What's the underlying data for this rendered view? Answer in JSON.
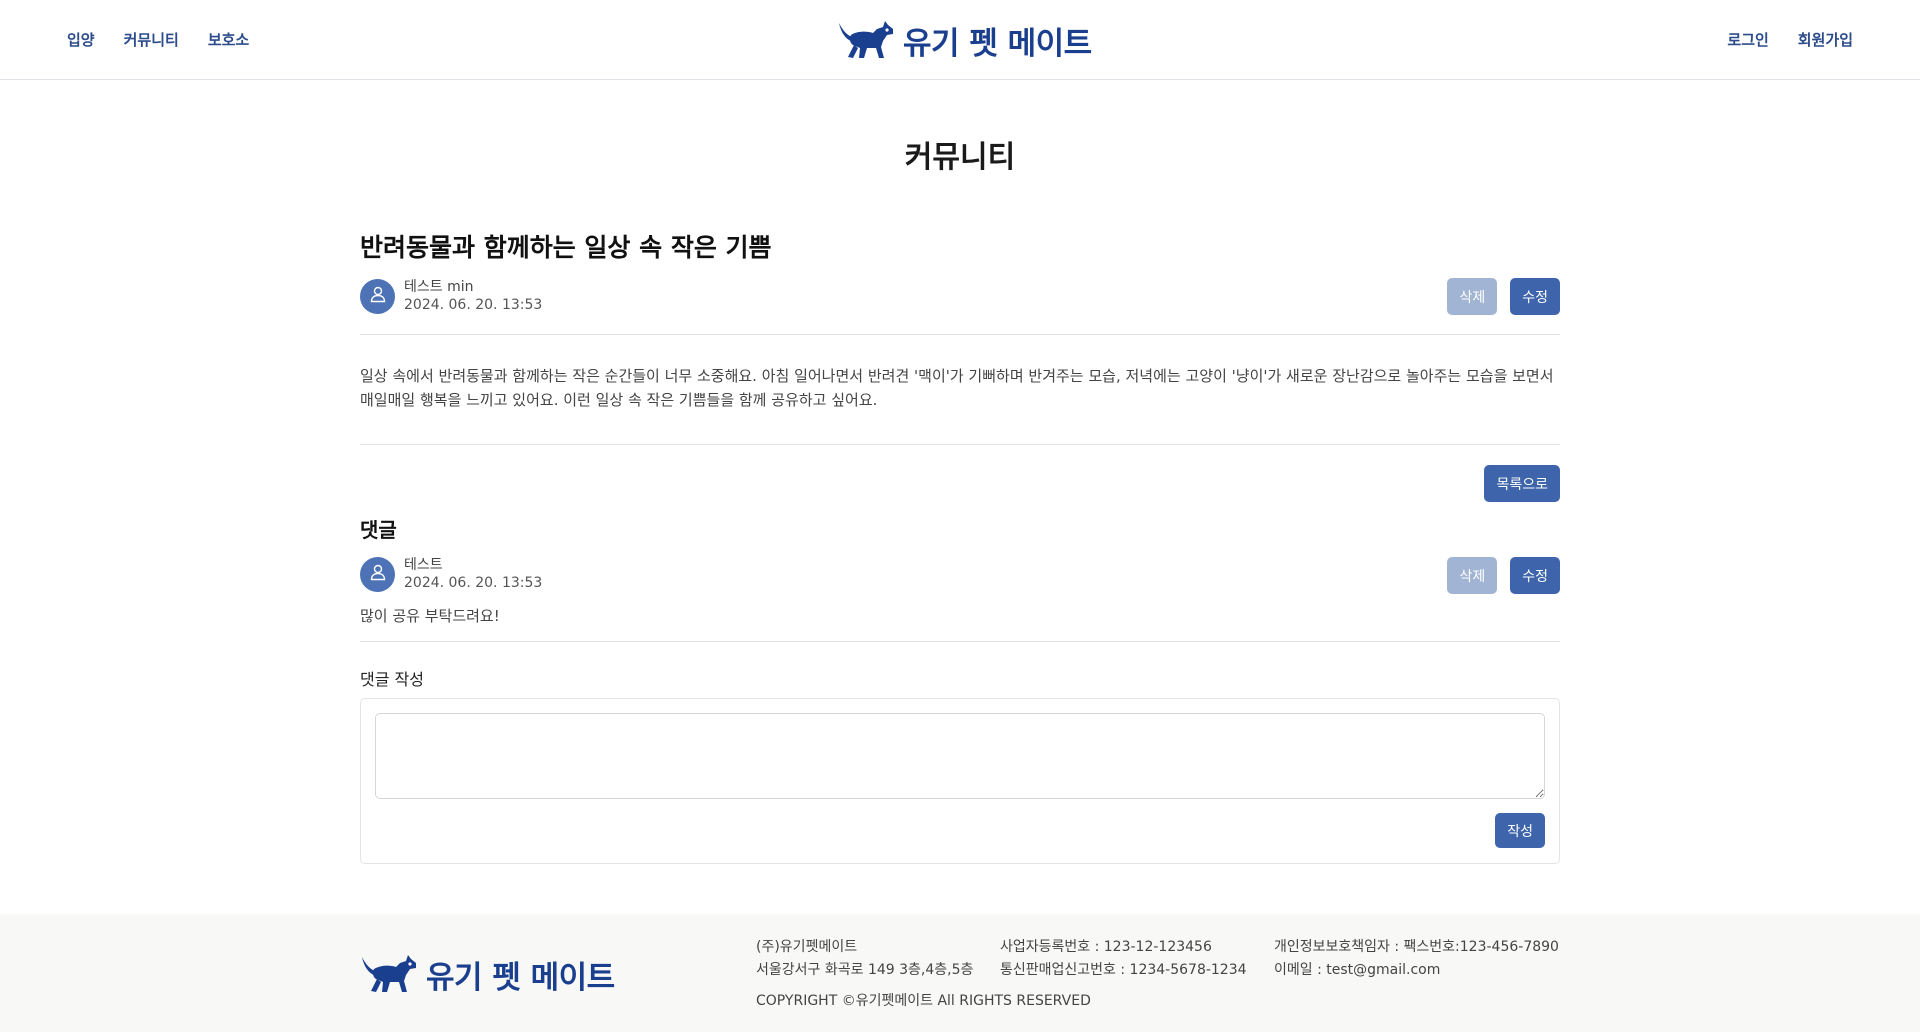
{
  "header": {
    "nav_left": [
      "입양",
      "커뮤니티",
      "보호소"
    ],
    "brand": "유기 펫 메이트",
    "nav_right": [
      "로그인",
      "회원가입"
    ],
    "brand_color": "#1b3f8f"
  },
  "page": {
    "title": "커뮤니티"
  },
  "post": {
    "title": "반려동물과 함께하는 일상 속 작은 기쁨",
    "author": "테스트 min",
    "date": "2024. 06. 20. 13:53",
    "delete_label": "삭제",
    "edit_label": "수정",
    "body": "일상 속에서 반려동물과 함께하는 작은 순간들이 너무 소중해요. 아침 일어나면서 반려견 '맥이'가 기뻐하며 반겨주는 모습, 저녁에는 고양이 '냥이'가 새로운 장난감으로 놀아주는 모습을 보면서 매일매일 행복을 느끼고 있어요. 이런 일상 속 작은 기쁨들을 함께 공유하고 싶어요.",
    "back_label": "목록으로"
  },
  "comments": {
    "title": "댓글",
    "items": [
      {
        "author": "테스트",
        "date": "2024. 06. 20. 13:53",
        "text": "많이 공유 부탁드려요!",
        "delete_label": "삭제",
        "edit_label": "수정"
      }
    ],
    "write": {
      "label": "댓글 작성",
      "textarea_value": "",
      "submit_label": "작성"
    }
  },
  "footer": {
    "brand": "유기 펫 메이트",
    "company": "(주)유기펫메이트",
    "address": "서울강서구 화곡로 149 3층,4층,5층",
    "business_no": "사업자등록번호 : 123-12-123456",
    "ecommerce_no": "통신판매업신고번호 : 1234-5678-1234",
    "privacy": "개인정보보호책임자 : 팩스번호:123-456-7890",
    "email": "이메일 : test@gmail.com",
    "copyright": "COPYRIGHT ©유기펫메이트 All RIGHTS RESERVED"
  },
  "icons": {
    "logo": "dog-logo-icon",
    "avatar": "user-icon"
  },
  "colors": {
    "primary_button": "#3e65ac",
    "muted_button": "#a1b4d3",
    "nav_link": "#2c4c8c",
    "avatar_bg": "#4d72b6"
  }
}
